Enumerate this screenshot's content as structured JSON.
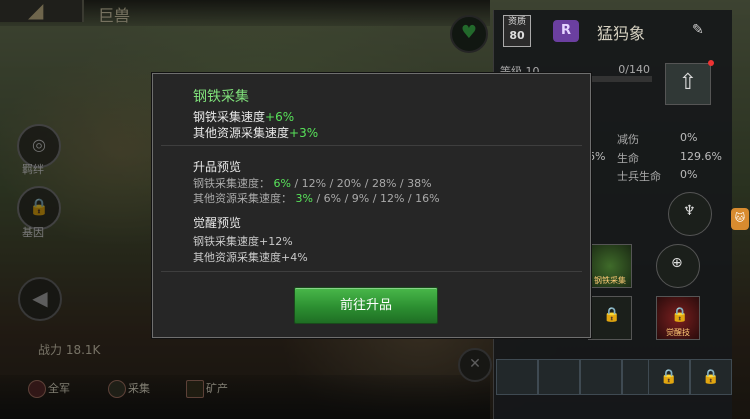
{
  "background": {
    "hero_name_top": "巨兽",
    "side_buttons": [
      {
        "label": "羁绊",
        "icon": "bond-icon"
      },
      {
        "label": "基因",
        "icon": "lock-icon"
      }
    ],
    "power": "战力 18.1K",
    "filters": [
      {
        "label": "全军",
        "icon": "army-icon"
      },
      {
        "label": "采集",
        "icon": "gather-icon"
      },
      {
        "label": "矿产",
        "icon": "mine-icon"
      }
    ]
  },
  "right_panel": {
    "quality_label": "资质",
    "quality_value": "80",
    "rank": "R",
    "hero_name": "猛犸象",
    "level_label": "等级 10",
    "level_progress": "0/140",
    "level_fraction": 0.0,
    "stats": [
      {
        "label": "减伤",
        "value": "0%"
      },
      {
        "label": "生命",
        "value": "129.6%"
      },
      {
        "label": "士兵生命",
        "value": "0%"
      }
    ],
    "stat_partial": "6%",
    "skill_labels": [
      "钢铁采集",
      "觉醒技"
    ]
  },
  "tooltip": {
    "title": "钢铁采集",
    "line1_prefix": "钢铁采集速度",
    "line1_value": "+6%",
    "line2_prefix": "其他资源采集速度",
    "line2_value": "+3%",
    "upgrade_heading": "升品预览",
    "upgrade_line1_prefix": "钢铁采集速度：",
    "upgrade_line1_current": "6%",
    "upgrade_line1_rest": " / 12% / 20% / 28% / 38%",
    "upgrade_line2_prefix": "其他资源采集速度：",
    "upgrade_line2_current": "3%",
    "upgrade_line2_rest": " / 6% / 9% / 12% / 16%",
    "awaken_heading": "觉醒预览",
    "awaken_line1": "钢铁采集速度+12%",
    "awaken_line2": "其他资源采集速度+4%",
    "button_label": "前往升品"
  },
  "colors": {
    "accent_green": "#58e35a",
    "title_green": "#7fe07a",
    "button_green": "#2c8f31"
  }
}
